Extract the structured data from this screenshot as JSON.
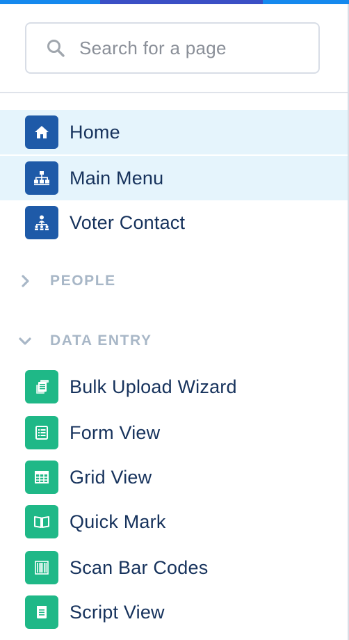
{
  "colors": {
    "top_bar_light": "#1589ee",
    "top_bar_dark": "#3b4fc5",
    "object_icon_blue": "#1e5aa8",
    "data_entry_icon_green": "#1fb887",
    "active_row_bg": "#e5f4fc"
  },
  "search": {
    "placeholder": "Search for a page",
    "value": ""
  },
  "nav": {
    "items": [
      {
        "label": "Home",
        "icon": "home-icon",
        "active": true
      },
      {
        "label": "Main Menu",
        "icon": "hierarchy-icon",
        "active": true
      },
      {
        "label": "Voter Contact",
        "icon": "team-hierarchy-icon",
        "active": false
      }
    ]
  },
  "sections": {
    "people": {
      "label": "PEOPLE",
      "expanded": false
    },
    "data_entry": {
      "label": "DATA ENTRY",
      "expanded": true,
      "items": [
        {
          "label": "Bulk Upload Wizard",
          "icon": "bulk-upload-icon"
        },
        {
          "label": "Form View",
          "icon": "form-icon"
        },
        {
          "label": "Grid View",
          "icon": "grid-icon"
        },
        {
          "label": "Quick Mark",
          "icon": "open-book-icon"
        },
        {
          "label": "Scan Bar Codes",
          "icon": "barcode-icon"
        },
        {
          "label": "Script View",
          "icon": "script-icon"
        }
      ]
    }
  }
}
